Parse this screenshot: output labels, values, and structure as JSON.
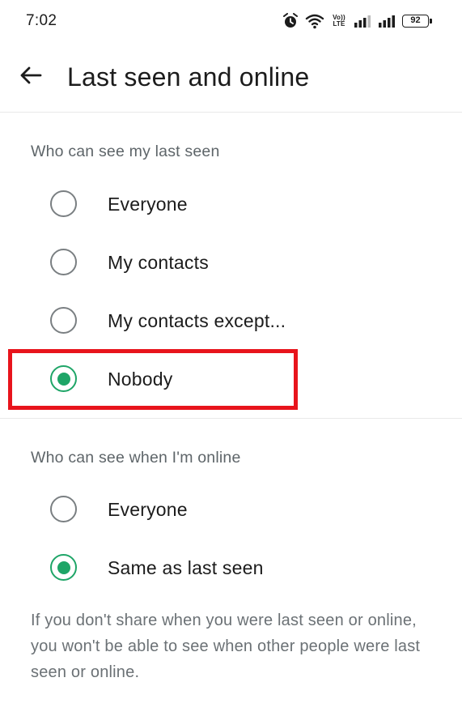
{
  "status_bar": {
    "time": "7:02",
    "volte_line1": "Vo))",
    "volte_line2": "LTE",
    "battery": "92",
    "icons": [
      "alarm-icon",
      "wifi-icon",
      "volte-icon",
      "signal-icon",
      "signal-icon",
      "battery-icon"
    ]
  },
  "app_bar": {
    "back_icon": "arrow-left-icon",
    "title": "Last seen and online"
  },
  "last_seen": {
    "header": "Who can see my last seen",
    "options": [
      {
        "label": "Everyone",
        "selected": false
      },
      {
        "label": "My contacts",
        "selected": false
      },
      {
        "label": "My contacts except...",
        "selected": false
      },
      {
        "label": "Nobody",
        "selected": true
      }
    ]
  },
  "online": {
    "header": "Who can see when I'm online",
    "options": [
      {
        "label": "Everyone",
        "selected": false
      },
      {
        "label": "Same as last seen",
        "selected": true
      }
    ]
  },
  "footnote": "If you don't share when you were last seen or online, you won't be able to see when other people were last seen or online.",
  "colors": {
    "accent": "#1ea567",
    "highlight": "#e8141c",
    "secondary_text": "#5e6569"
  }
}
